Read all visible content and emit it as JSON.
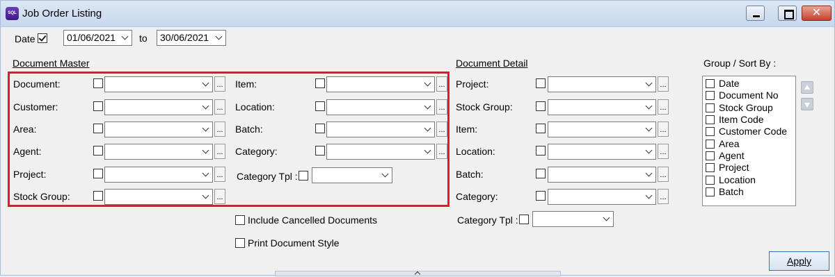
{
  "window": {
    "title": "Job Order Listing",
    "app_icon_text": "SQL",
    "close_glyph": "✕"
  },
  "date_filter": {
    "label": "Date",
    "checked": true,
    "from": "01/06/2021",
    "to_label": "to",
    "to": "30/06/2021"
  },
  "document_master": {
    "title": "Document Master",
    "left_fields": [
      {
        "label": "Document:"
      },
      {
        "label": "Customer:"
      },
      {
        "label": "Area:"
      },
      {
        "label": "Agent:"
      },
      {
        "label": "Project:"
      },
      {
        "label": "Stock Group:"
      }
    ],
    "right_fields": [
      {
        "label": "Item:"
      },
      {
        "label": "Location:"
      },
      {
        "label": "Batch:"
      },
      {
        "label": "Category:"
      }
    ],
    "category_tpl_label": "Category Tpl :"
  },
  "options": {
    "include_cancelled": "Include Cancelled Documents",
    "print_document_style": "Print Document Style"
  },
  "document_detail": {
    "title": "Document Detail",
    "fields": [
      {
        "label": "Project:"
      },
      {
        "label": "Stock Group:"
      },
      {
        "label": "Item:"
      },
      {
        "label": "Location:"
      },
      {
        "label": "Batch:"
      },
      {
        "label": "Category:"
      }
    ],
    "category_tpl_label": "Category Tpl :"
  },
  "group_sort": {
    "title": "Group / Sort By :",
    "items": [
      "Date",
      "Document No",
      "Stock Group",
      "Item Code",
      "Customer Code",
      "Area",
      "Agent",
      "Project",
      "Location",
      "Batch"
    ]
  },
  "ellipsis": "...",
  "apply_label": "Apply",
  "colors": {
    "highlight": "#e21b23",
    "accent": "#3b6fb6"
  }
}
